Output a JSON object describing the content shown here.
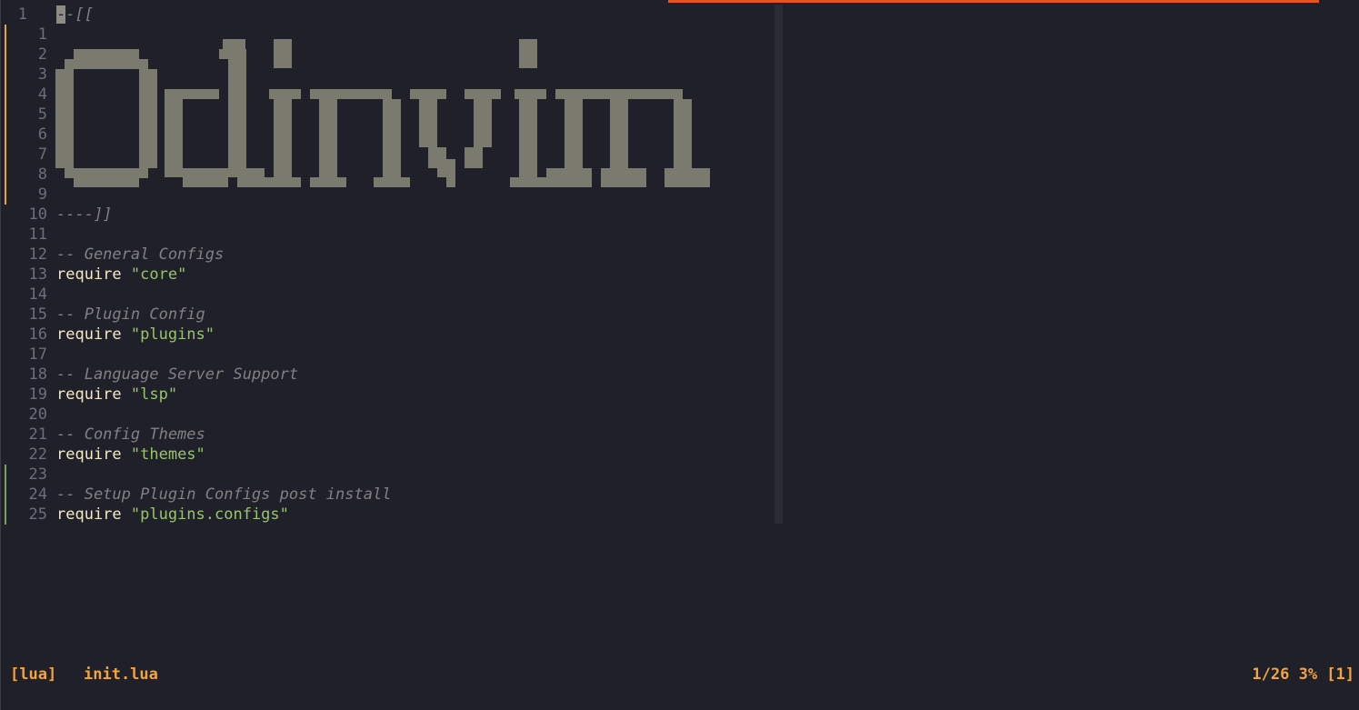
{
  "editor": {
    "lines": [
      {
        "number": "1",
        "indent": "0",
        "tokens": [
          {
            "type": "cursor",
            "text": "-"
          },
          {
            "type": "comment",
            "text": "-[["
          }
        ]
      },
      {
        "number": "1",
        "indent": "1",
        "tokens": []
      },
      {
        "number": "2",
        "indent": "1",
        "tokens": []
      },
      {
        "number": "3",
        "indent": "1",
        "tokens": []
      },
      {
        "number": "4",
        "indent": "1",
        "tokens": []
      },
      {
        "number": "5",
        "indent": "1",
        "tokens": []
      },
      {
        "number": "6",
        "indent": "1",
        "tokens": []
      },
      {
        "number": "7",
        "indent": "1",
        "tokens": []
      },
      {
        "number": "8",
        "indent": "1",
        "tokens": []
      },
      {
        "number": "9",
        "indent": "1",
        "tokens": []
      },
      {
        "number": "10",
        "indent": "1",
        "tokens": [
          {
            "type": "comment",
            "text": "----]]"
          }
        ]
      },
      {
        "number": "11",
        "indent": "1",
        "tokens": []
      },
      {
        "number": "12",
        "indent": "1",
        "tokens": [
          {
            "type": "comment",
            "text": "-- General Configs"
          }
        ]
      },
      {
        "number": "13",
        "indent": "1",
        "tokens": [
          {
            "type": "keyword",
            "text": "require "
          },
          {
            "type": "string",
            "text": "\"core\""
          }
        ]
      },
      {
        "number": "14",
        "indent": "1",
        "tokens": []
      },
      {
        "number": "15",
        "indent": "1",
        "tokens": [
          {
            "type": "comment",
            "text": "-- Plugin Config"
          }
        ]
      },
      {
        "number": "16",
        "indent": "1",
        "tokens": [
          {
            "type": "keyword",
            "text": "require "
          },
          {
            "type": "string",
            "text": "\"plugins\""
          }
        ]
      },
      {
        "number": "17",
        "indent": "1",
        "tokens": []
      },
      {
        "number": "18",
        "indent": "1",
        "tokens": [
          {
            "type": "comment",
            "text": "-- Language Server Support"
          }
        ]
      },
      {
        "number": "19",
        "indent": "1",
        "tokens": [
          {
            "type": "keyword",
            "text": "require "
          },
          {
            "type": "string",
            "text": "\"lsp\""
          }
        ]
      },
      {
        "number": "20",
        "indent": "1",
        "tokens": []
      },
      {
        "number": "21",
        "indent": "1",
        "tokens": [
          {
            "type": "comment",
            "text": "-- Config Themes"
          }
        ]
      },
      {
        "number": "22",
        "indent": "1",
        "tokens": [
          {
            "type": "keyword",
            "text": "require "
          },
          {
            "type": "string",
            "text": "\"themes\""
          }
        ]
      },
      {
        "number": "23",
        "indent": "1",
        "tokens": []
      },
      {
        "number": "24",
        "indent": "1",
        "tokens": [
          {
            "type": "comment",
            "text": "-- Setup Plugin Configs post install"
          }
        ]
      },
      {
        "number": "25",
        "indent": "1",
        "tokens": [
          {
            "type": "keyword",
            "text": "require "
          },
          {
            "type": "string",
            "text": "\"plugins.configs\""
          }
        ]
      }
    ],
    "git_signs": [
      {
        "from_line": 1,
        "to_line": 9,
        "color": "#e8a33c"
      },
      {
        "from_line": 23,
        "to_line": 25,
        "color": "#6fa35a"
      }
    ],
    "ascii_art": {
      "color": "#7b7a6e",
      "text": "Odinvim"
    }
  },
  "statusline": {
    "filetype": "[lua]",
    "filename": "init.lua",
    "position": "1/26 3% [1]"
  },
  "colors": {
    "background": "#1f202a",
    "accent": "#e8541b",
    "status": "#f3a43a"
  }
}
